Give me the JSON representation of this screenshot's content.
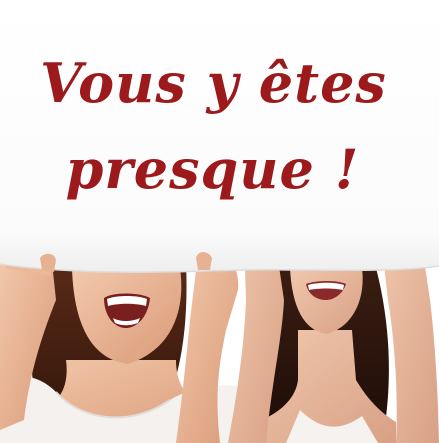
{
  "headline": {
    "line1": "Vous y  êtes",
    "line2": "presque !"
  },
  "colors": {
    "headline": "#9c1a1c",
    "background": "#ffffff"
  },
  "image": {
    "subject": "two-smiling-women-holding-paper-sign"
  }
}
